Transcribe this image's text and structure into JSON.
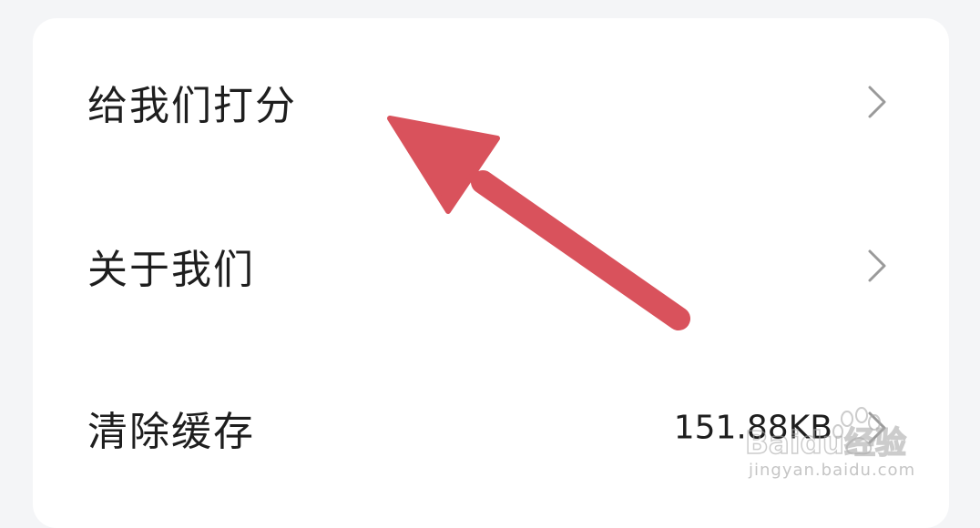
{
  "settings": {
    "items": [
      {
        "label": "给我们打分"
      },
      {
        "label": "关于我们"
      },
      {
        "label": "清除缓存",
        "value": "151.88KB"
      }
    ]
  },
  "watermark": {
    "logo_text": "Baidu经验",
    "url": "jingyan.baidu.com"
  },
  "annotation": {
    "arrow_color": "#d9525c",
    "arrow_icon": "red-arrow-pointer"
  }
}
